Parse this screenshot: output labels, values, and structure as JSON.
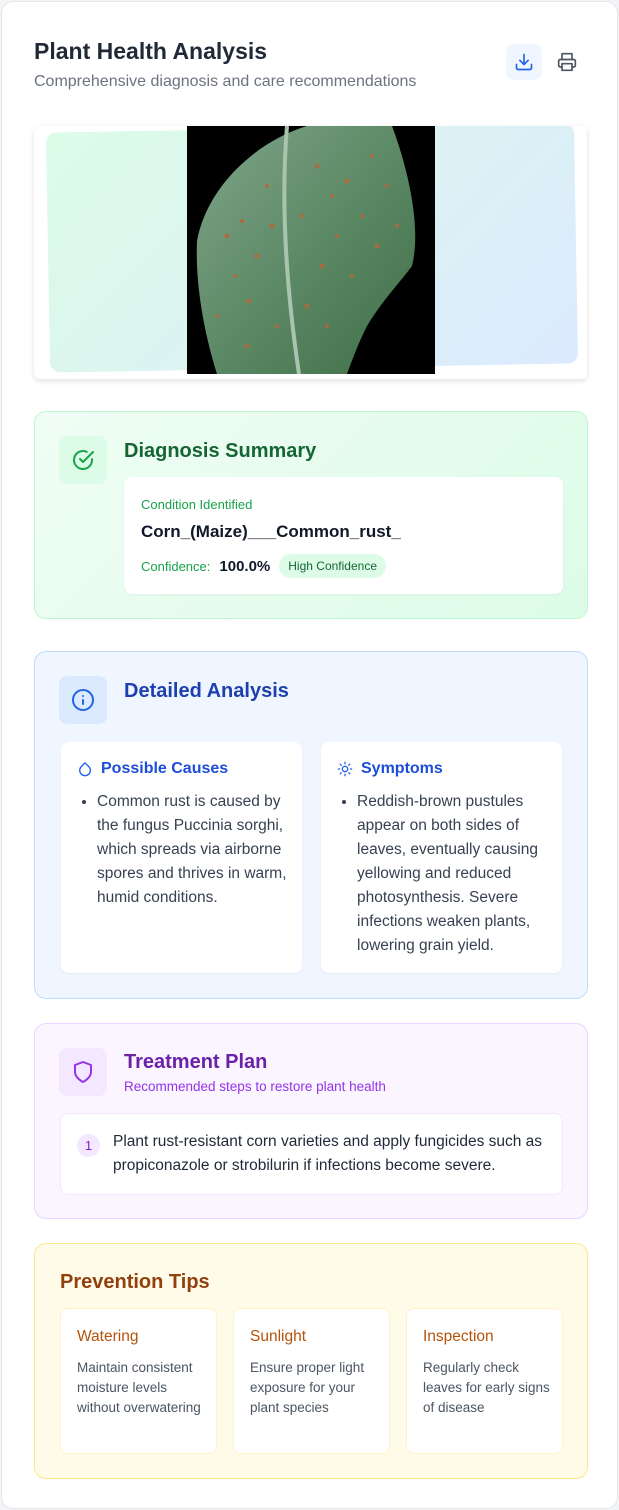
{
  "header": {
    "title": "Plant Health Analysis",
    "subtitle": "Comprehensive diagnosis and care recommendations"
  },
  "icons": {
    "download": "download-icon",
    "print": "printer-icon",
    "diagnosis": "check-circle-icon",
    "analysis": "info-icon",
    "causes": "droplet-icon",
    "symptoms": "sun-icon",
    "treatment": "shield-icon"
  },
  "colors": {
    "diagnosis_accent": "#166534",
    "analysis_accent": "#1e40af",
    "treatment_accent": "#6b21a8",
    "prevention_accent": "#92400e"
  },
  "diagnosis": {
    "title": "Diagnosis Summary",
    "condition_label": "Condition Identified",
    "condition_value": "Corn_(Maize)___Common_rust_",
    "confidence_label": "Confidence:",
    "confidence_value": "100.0%",
    "confidence_badge": "High Confidence"
  },
  "analysis": {
    "title": "Detailed Analysis",
    "causes": {
      "title": "Possible Causes",
      "items": [
        "Common rust is caused by the fungus Puccinia sorghi, which spreads via airborne spores and thrives in warm, humid conditions."
      ]
    },
    "symptoms": {
      "title": "Symptoms",
      "items": [
        "Reddish-brown pustules appear on both sides of leaves, eventually causing yellowing and reduced photosynthesis. Severe infections weaken plants, lowering grain yield."
      ]
    }
  },
  "treatment": {
    "title": "Treatment Plan",
    "subtitle": "Recommended steps to restore plant health",
    "steps": [
      {
        "number": "1",
        "text": "Plant rust-resistant corn varieties and apply fungicides such as propiconazole or strobilurin if infections become severe."
      }
    ]
  },
  "prevention": {
    "title": "Prevention Tips",
    "tips": [
      {
        "title": "Watering",
        "description": "Maintain consistent moisture levels without overwatering"
      },
      {
        "title": "Sunlight",
        "description": "Ensure proper light exposure for your plant species"
      },
      {
        "title": "Inspection",
        "description": "Regularly check leaves for early signs of disease"
      }
    ]
  }
}
